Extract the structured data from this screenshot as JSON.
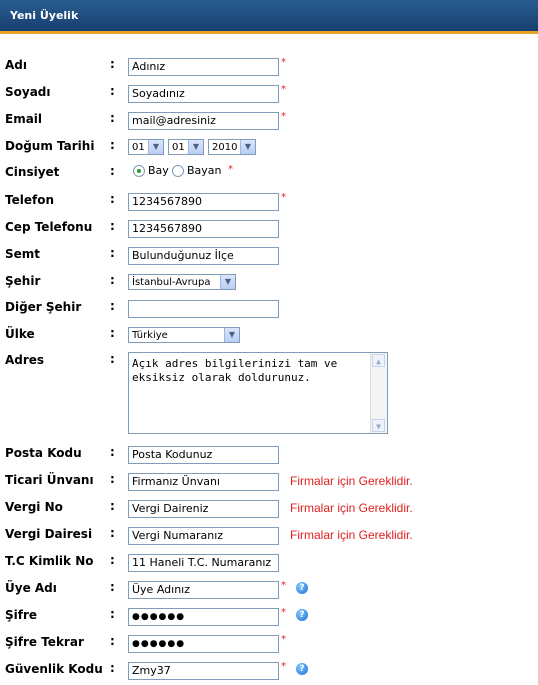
{
  "header": {
    "title": "Yeni Üyelik"
  },
  "colon": ":",
  "required_mark": "*",
  "help_glyph": "?",
  "fields": {
    "ad": {
      "label": "Adı",
      "value": "Adınız"
    },
    "soyad": {
      "label": "Soyadı",
      "value": "Soyadınız"
    },
    "email": {
      "label": "Email",
      "value": "mail@adresiniz"
    },
    "dogum": {
      "label": "Doğum Tarihi",
      "day": "01",
      "month": "01",
      "year": "2010"
    },
    "cinsiyet": {
      "label": "Cinsiyet",
      "option1": "Bay",
      "option2": "Bayan",
      "selected": "Bay"
    },
    "telefon": {
      "label": "Telefon",
      "value": "1234567890"
    },
    "cep": {
      "label": "Cep Telefonu",
      "value": "1234567890"
    },
    "semt": {
      "label": "Semt",
      "value": "Bulunduğunuz İlçe"
    },
    "sehir": {
      "label": "Şehir",
      "value": "İstanbul-Avrupa"
    },
    "diger_sehir": {
      "label": "Diğer Şehir",
      "value": ""
    },
    "ulke": {
      "label": "Ülke",
      "value": "Türkiye"
    },
    "adres": {
      "label": "Adres",
      "value": "Açık adres bilgilerinizi tam ve eksiksiz olarak doldurunuz."
    },
    "posta": {
      "label": "Posta Kodu",
      "value": "Posta Kodunuz"
    },
    "ticari": {
      "label": "Ticari Ünvanı",
      "value": "Firmanız Ünvanı",
      "note": "Firmalar için Gereklidir."
    },
    "vergi_no": {
      "label": "Vergi No",
      "value": "Vergi Daireniz",
      "note": "Firmalar için Gereklidir."
    },
    "vergi_dairesi": {
      "label": "Vergi Dairesi",
      "value": "Vergi Numaranız",
      "note": "Firmalar için Gereklidir."
    },
    "tc": {
      "label": "T.C Kimlik No",
      "value": "11 Haneli T.C. Numaranız"
    },
    "uye_adi": {
      "label": "Üye Adı",
      "value": "Üye Adınız"
    },
    "sifre": {
      "label": "Şifre",
      "value": "●●●●●●"
    },
    "sifre_tekrar": {
      "label": "Şifre Tekrar",
      "value": "●●●●●●"
    },
    "guvenlik": {
      "label": "Güvenlik Kodu",
      "value": "Zmy37"
    }
  }
}
